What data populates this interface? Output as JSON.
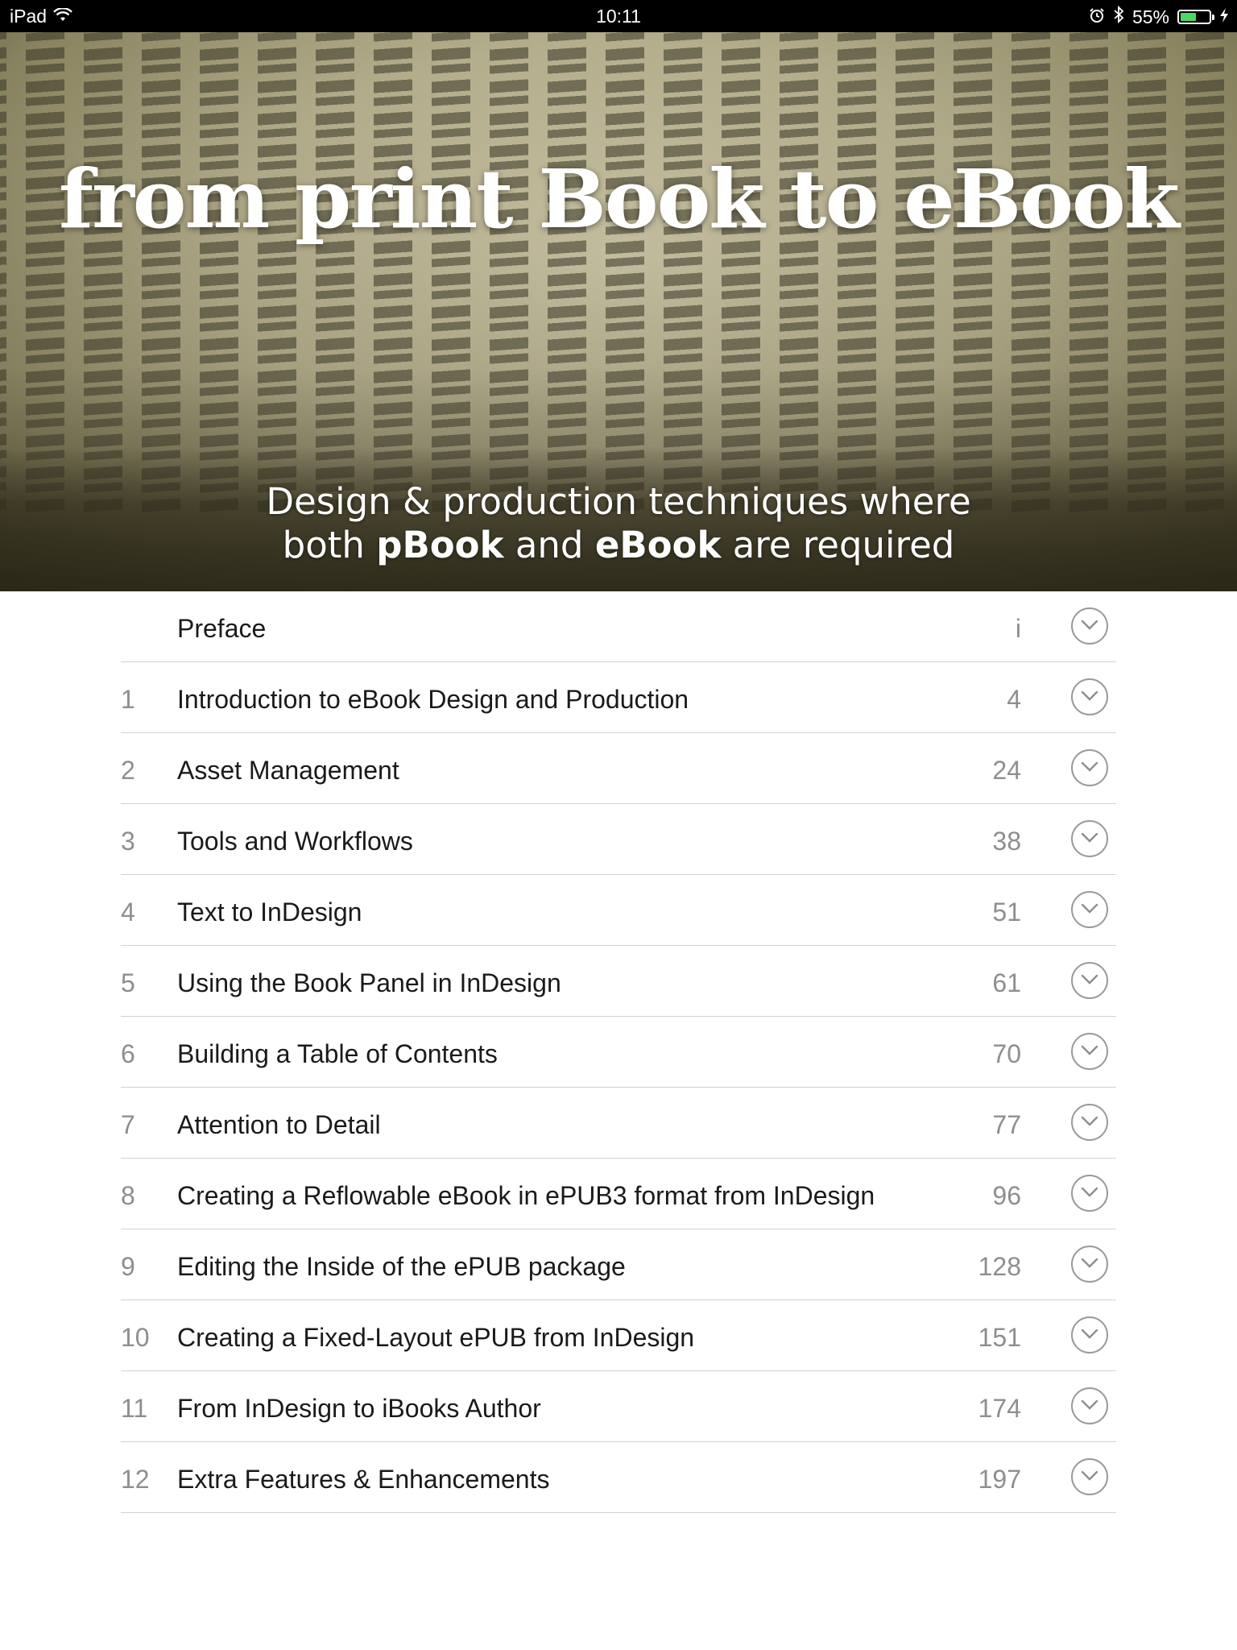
{
  "status_bar": {
    "device": "iPad",
    "time": "10:11",
    "battery_percent": "55%",
    "battery_level": 0.55,
    "icons": [
      "wifi-icon",
      "alarm-icon",
      "bluetooth-icon",
      "battery-icon",
      "charging-icon"
    ]
  },
  "cover": {
    "title": "from print Book to eBook",
    "subtitle_line1": "Design & production techniques where",
    "subtitle_line2_a": "both ",
    "subtitle_line2_b": "pBook",
    "subtitle_line2_c": " and ",
    "subtitle_line2_d": "eBook",
    "subtitle_line2_e": " are required"
  },
  "toc": {
    "rows": [
      {
        "num": "",
        "title": "Preface",
        "page": "i"
      },
      {
        "num": "1",
        "title": "Introduction to eBook Design and Production",
        "page": "4"
      },
      {
        "num": "2",
        "title": "Asset Management",
        "page": "24"
      },
      {
        "num": "3",
        "title": "Tools and Workflows",
        "page": "38"
      },
      {
        "num": "4",
        "title": "Text to InDesign",
        "page": "51"
      },
      {
        "num": "5",
        "title": "Using the Book Panel in InDesign",
        "page": "61"
      },
      {
        "num": "6",
        "title": "Building a Table of Contents",
        "page": "70"
      },
      {
        "num": "7",
        "title": "Attention to Detail",
        "page": "77"
      },
      {
        "num": "8",
        "title": "Creating a Reflowable eBook in ePUB3 format from InDesign",
        "page": "96"
      },
      {
        "num": "9",
        "title": "Editing the Inside of the ePUB package",
        "page": "128"
      },
      {
        "num": "10",
        "title": "Creating a Fixed-Layout ePUB from InDesign",
        "page": "151"
      },
      {
        "num": "11",
        "title": "From InDesign to iBooks Author",
        "page": "174"
      },
      {
        "num": "12",
        "title": "Extra Features & Enhancements",
        "page": "197"
      }
    ],
    "expand_icon": "chevron-down-icon"
  },
  "colors": {
    "status_bar_bg": "#000000",
    "battery_fill": "#4cd964",
    "title_text": "#1a1a1a",
    "muted_text": "#8e8e8e",
    "divider": "#d2d2d2"
  }
}
